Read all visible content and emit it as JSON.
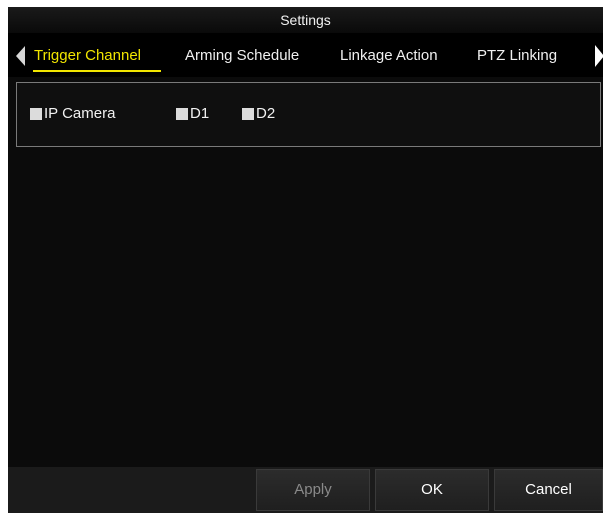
{
  "window": {
    "title": "Settings"
  },
  "tabs": [
    {
      "label": "Trigger Channel",
      "active": true
    },
    {
      "label": "Arming Schedule",
      "active": false
    },
    {
      "label": "Linkage Action",
      "active": false
    },
    {
      "label": "PTZ Linking",
      "active": false
    }
  ],
  "channels": [
    {
      "label": "IP Camera",
      "checked": false
    },
    {
      "label": "D1",
      "checked": false
    },
    {
      "label": "D2",
      "checked": false
    }
  ],
  "buttons": {
    "apply": "Apply",
    "ok": "OK",
    "cancel": "Cancel"
  },
  "colors": {
    "active_tab": "#f2e600",
    "background": "#0b0b0b",
    "text": "#f2f2f2"
  }
}
